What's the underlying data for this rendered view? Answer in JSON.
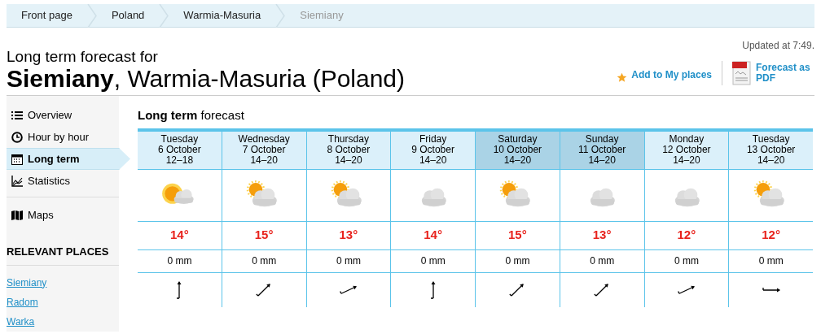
{
  "breadcrumb": [
    {
      "label": "Front page",
      "current": false
    },
    {
      "label": "Poland",
      "current": false
    },
    {
      "label": "Warmia-Masuria",
      "current": false
    },
    {
      "label": "Siemiany",
      "current": true
    }
  ],
  "updated": "Updated at 7:49.",
  "heading": {
    "subtitle": "Long term forecast for",
    "place": "Siemiany",
    "region": ", Warmia-Masuria (Poland)"
  },
  "actions": [
    {
      "label": "Add to My places",
      "kind": "star"
    },
    {
      "label": "Forecast as PDF",
      "kind": "pdf"
    }
  ],
  "sidebar": {
    "items": [
      {
        "label": "Overview",
        "kind": "list",
        "selected": false
      },
      {
        "label": "Hour by hour",
        "kind": "clock",
        "selected": false
      },
      {
        "label": "Long term",
        "kind": "calendar",
        "selected": true
      },
      {
        "label": "Statistics",
        "kind": "chart",
        "selected": false
      },
      {
        "label": "Maps",
        "kind": "map",
        "selected": false
      }
    ],
    "relevant_title": "RELEVANT PLACES",
    "places": [
      "Siemiany",
      "Radom",
      "Warka"
    ]
  },
  "forecast": {
    "title": "**Long term** forecast",
    "days": [
      {
        "day": "Tuesday",
        "date": "6 October",
        "hours": "12–18",
        "weekend": false,
        "weather": {
          "kind": "sunny_cloud"
        },
        "temp": "14°",
        "precip": "0 mm",
        "wind": {
          "kind": "N"
        }
      },
      {
        "day": "Wednesday",
        "date": "7 October",
        "hours": "14–20",
        "weekend": false,
        "weather": {
          "kind": "partly_cloudy"
        },
        "temp": "15°",
        "precip": "0 mm",
        "wind": {
          "kind": "NE"
        }
      },
      {
        "day": "Thursday",
        "date": "8 October",
        "hours": "14–20",
        "weekend": false,
        "weather": {
          "kind": "partly_cloudy"
        },
        "temp": "13°",
        "precip": "0 mm",
        "wind": {
          "kind": "ENE"
        }
      },
      {
        "day": "Friday",
        "date": "9 October",
        "hours": "14–20",
        "weekend": false,
        "weather": {
          "kind": "cloudy"
        },
        "temp": "14°",
        "precip": "0 mm",
        "wind": {
          "kind": "N"
        }
      },
      {
        "day": "Saturday",
        "date": "10 October",
        "hours": "14–20",
        "weekend": true,
        "weather": {
          "kind": "partly_cloudy"
        },
        "temp": "15°",
        "precip": "0 mm",
        "wind": {
          "kind": "NE"
        }
      },
      {
        "day": "Sunday",
        "date": "11 October",
        "hours": "14–20",
        "weekend": true,
        "weather": {
          "kind": "cloudy"
        },
        "temp": "13°",
        "precip": "0 mm",
        "wind": {
          "kind": "NE"
        }
      },
      {
        "day": "Monday",
        "date": "12 October",
        "hours": "14–20",
        "weekend": false,
        "weather": {
          "kind": "cloudy"
        },
        "temp": "12°",
        "precip": "0 mm",
        "wind": {
          "kind": "ENE"
        }
      },
      {
        "day": "Tuesday",
        "date": "13 October",
        "hours": "14–20",
        "weekend": false,
        "weather": {
          "kind": "partly_cloudy"
        },
        "temp": "12°",
        "precip": "0 mm",
        "wind": {
          "kind": "E"
        }
      }
    ]
  }
}
